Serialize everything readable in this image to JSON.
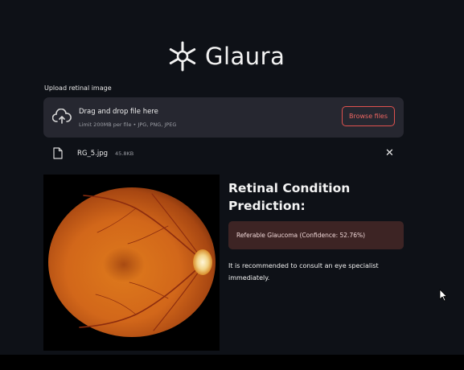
{
  "app": {
    "name": "Glaura"
  },
  "upload": {
    "label": "Upload retinal image",
    "dropzone_title": "Drag and drop file here",
    "dropzone_limit": "Limit 200MB per file • JPG, PNG, JPEG",
    "browse_label": "Browse files"
  },
  "file": {
    "name": "RG_5.jpg",
    "size": "45.8KB",
    "remove_icon": "close-icon"
  },
  "result": {
    "title": "Retinal Condition Prediction:",
    "prediction": "Referable Glaucoma (Confidence: 52.76%)",
    "advice": "It is recommended to consult an eye specialist immediately."
  },
  "colors": {
    "background": "#0e1117",
    "dropzone": "#262730",
    "accent": "#e0524f",
    "alert_bg": "#3d2424"
  }
}
